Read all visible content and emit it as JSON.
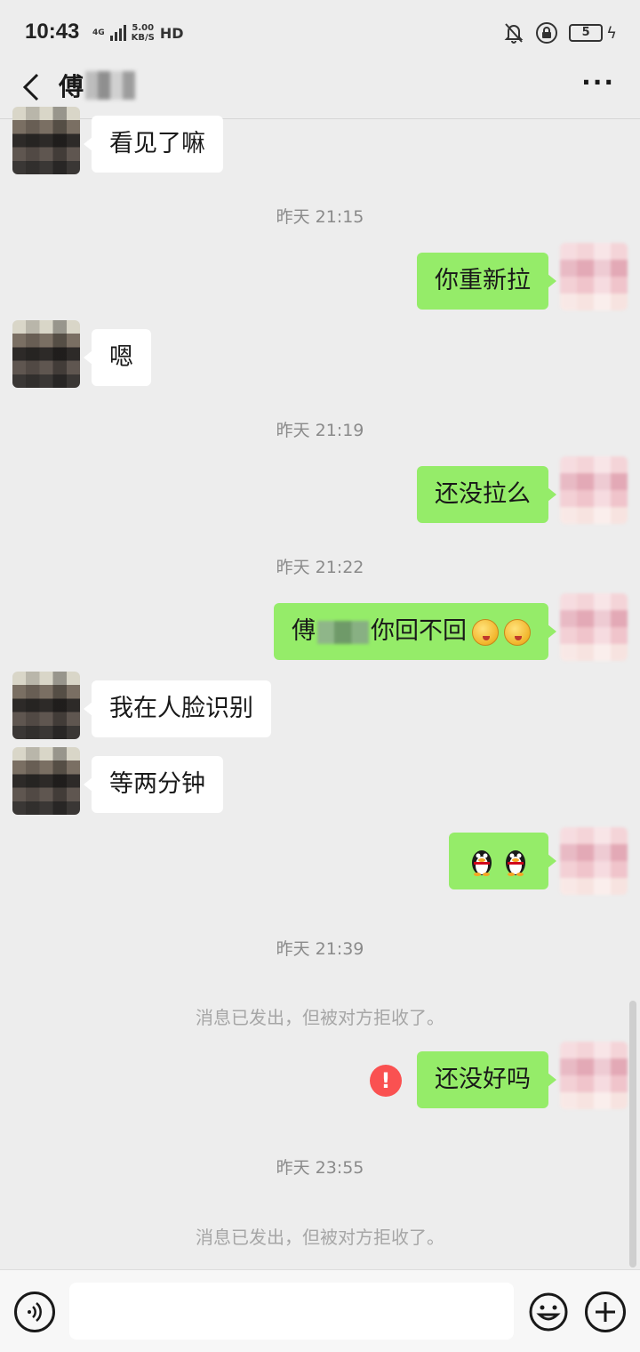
{
  "status_bar": {
    "time": "10:43",
    "network_type": "4G",
    "speed_value": "5.00",
    "speed_unit": "KB/S",
    "hd_label": "HD",
    "battery_level": "5"
  },
  "header": {
    "title_char": "傅"
  },
  "messages": {
    "m1": "看见了嘛",
    "t1": "昨天 21:15",
    "m2": "你重新拉",
    "m3": "嗯",
    "t2": "昨天 21:19",
    "m4": "还没拉么",
    "t3": "昨天 21:22",
    "m5_prefix": "傅",
    "m5_suffix": "你回不回",
    "m6": "我在人脸识别",
    "m7": "等两分钟",
    "t4": "昨天 21:39",
    "sys1": "消息已发出，但被对方拒收了。",
    "m8": "还没好吗",
    "error_mark": "!",
    "t5": "昨天 23:55",
    "sys2": "消息已发出，但被对方拒收了。"
  },
  "input": {
    "value": ""
  },
  "colors": {
    "background": "#ededed",
    "sent_bubble": "#95ec69",
    "received_bubble": "#ffffff",
    "error": "#fa5151"
  }
}
